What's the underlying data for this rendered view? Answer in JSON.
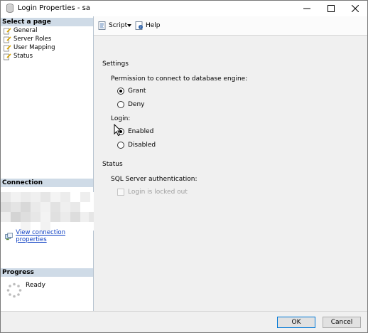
{
  "window": {
    "title": "Login Properties - sa",
    "controls": {
      "minimize": "—",
      "maximize": "☐",
      "close": "✕"
    }
  },
  "left": {
    "select_page_header": "Select a page",
    "pages": [
      {
        "label": "General",
        "icon": "page-icon"
      },
      {
        "label": "Server Roles",
        "icon": "page-icon"
      },
      {
        "label": "User Mapping",
        "icon": "page-icon"
      },
      {
        "label": "Status",
        "icon": "page-icon"
      }
    ],
    "connection_header": "Connection",
    "view_connection_properties": "View connection properties",
    "progress_header": "Progress",
    "progress_status": "Ready"
  },
  "toolbar": {
    "script_label": "Script",
    "help_label": "Help"
  },
  "content": {
    "settings_heading": "Settings",
    "permission_label": "Permission to connect to database engine:",
    "permission_options": [
      {
        "label": "Grant",
        "selected": true
      },
      {
        "label": "Deny",
        "selected": false
      }
    ],
    "login_label": "Login:",
    "login_options": [
      {
        "label": "Enabled",
        "selected": true
      },
      {
        "label": "Disabled",
        "selected": false
      }
    ],
    "status_heading": "Status",
    "sql_auth_label": "SQL Server authentication:",
    "locked_out_label": "Login is locked out",
    "locked_out_checked": false,
    "locked_out_enabled": false
  },
  "buttons": {
    "ok": "OK",
    "cancel": "Cancel"
  },
  "colors": {
    "section_header_bg": "#cfdbe7",
    "link": "#0a3cc2",
    "panel_bg": "#f0f0f0"
  }
}
